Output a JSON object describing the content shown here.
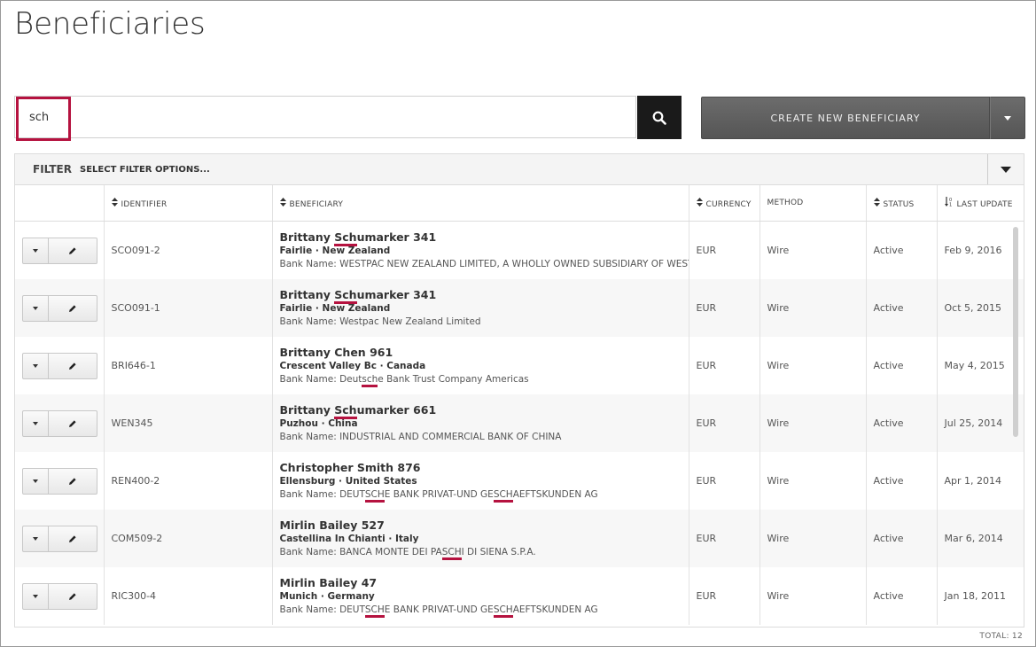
{
  "page": {
    "title": "Beneficiaries"
  },
  "search": {
    "value": "sch",
    "placeholder": ""
  },
  "toolbar": {
    "create_label": "CREATE NEW BENEFICIARY"
  },
  "filter": {
    "label": "FILTER",
    "options_label": "SELECT FILTER OPTIONS..."
  },
  "columns": {
    "identifier": "IDENTIFIER",
    "beneficiary": "BENEFICIARY",
    "currency": "CURRENCY",
    "method": "METHOD",
    "status": "STATUS",
    "last_update": "LAST UPDATE"
  },
  "rows": [
    {
      "identifier": "SCO091-2",
      "name": "Brittany Schumarker 341",
      "location": "Fairlie · New Zealand",
      "bank": "Bank Name: WESTPAC NEW ZEALAND LIMITED, A WHOLLY OWNED SUBSIDIARY OF WESTI",
      "currency": "EUR",
      "method": "Wire",
      "status": "Active",
      "last_update": "Feb 9, 2016"
    },
    {
      "identifier": "SCO091-1",
      "name": "Brittany Schumarker 341",
      "location": "Fairlie · New Zealand",
      "bank": "Bank Name: Westpac New Zealand Limited",
      "currency": "EUR",
      "method": "Wire",
      "status": "Active",
      "last_update": "Oct 5, 2015"
    },
    {
      "identifier": "BRI646-1",
      "name": "Brittany Chen 961",
      "location": "Crescent Valley Bc · Canada",
      "bank": "Bank Name: Deutsche Bank Trust Company Americas",
      "currency": "EUR",
      "method": "Wire",
      "status": "Active",
      "last_update": "May 4, 2015"
    },
    {
      "identifier": "WEN345",
      "name": "Brittany Schumarker 661",
      "location": "Puzhou · China",
      "bank": "Bank Name: INDUSTRIAL AND COMMERCIAL BANK OF CHINA",
      "currency": "EUR",
      "method": "Wire",
      "status": "Active",
      "last_update": "Jul 25, 2014"
    },
    {
      "identifier": "REN400-2",
      "name": "Christopher Smith 876",
      "location": "Ellensburg · United States",
      "bank": "Bank Name: DEUTSCHE BANK PRIVAT-UND GESCHAEFTSKUNDEN AG",
      "currency": "EUR",
      "method": "Wire",
      "status": "Active",
      "last_update": "Apr 1, 2014"
    },
    {
      "identifier": "COM509-2",
      "name": "Mirlin Bailey 527",
      "location": "Castellina In Chianti · Italy",
      "bank": "Bank Name: BANCA MONTE DEI PASCHI DI SIENA S.P.A.",
      "currency": "EUR",
      "method": "Wire",
      "status": "Active",
      "last_update": "Mar 6, 2014"
    },
    {
      "identifier": "RIC300-4",
      "name": "Mirlin Bailey 47",
      "location": "Munich · Germany",
      "bank": "Bank Name: DEUTSCHE BANK PRIVAT-UND GESCHAEFTSKUNDEN AG",
      "currency": "EUR",
      "method": "Wire",
      "status": "Active",
      "last_update": "Jan 18, 2011"
    }
  ],
  "footer": {
    "total": "TOTAL: 12"
  },
  "colors": {
    "accent": "#b5123f",
    "button_dark": "#1a1a1a",
    "button_gray": "#606060"
  },
  "icons": [
    "search-icon",
    "chevron-down-icon",
    "pencil-icon",
    "sort-icon"
  ]
}
